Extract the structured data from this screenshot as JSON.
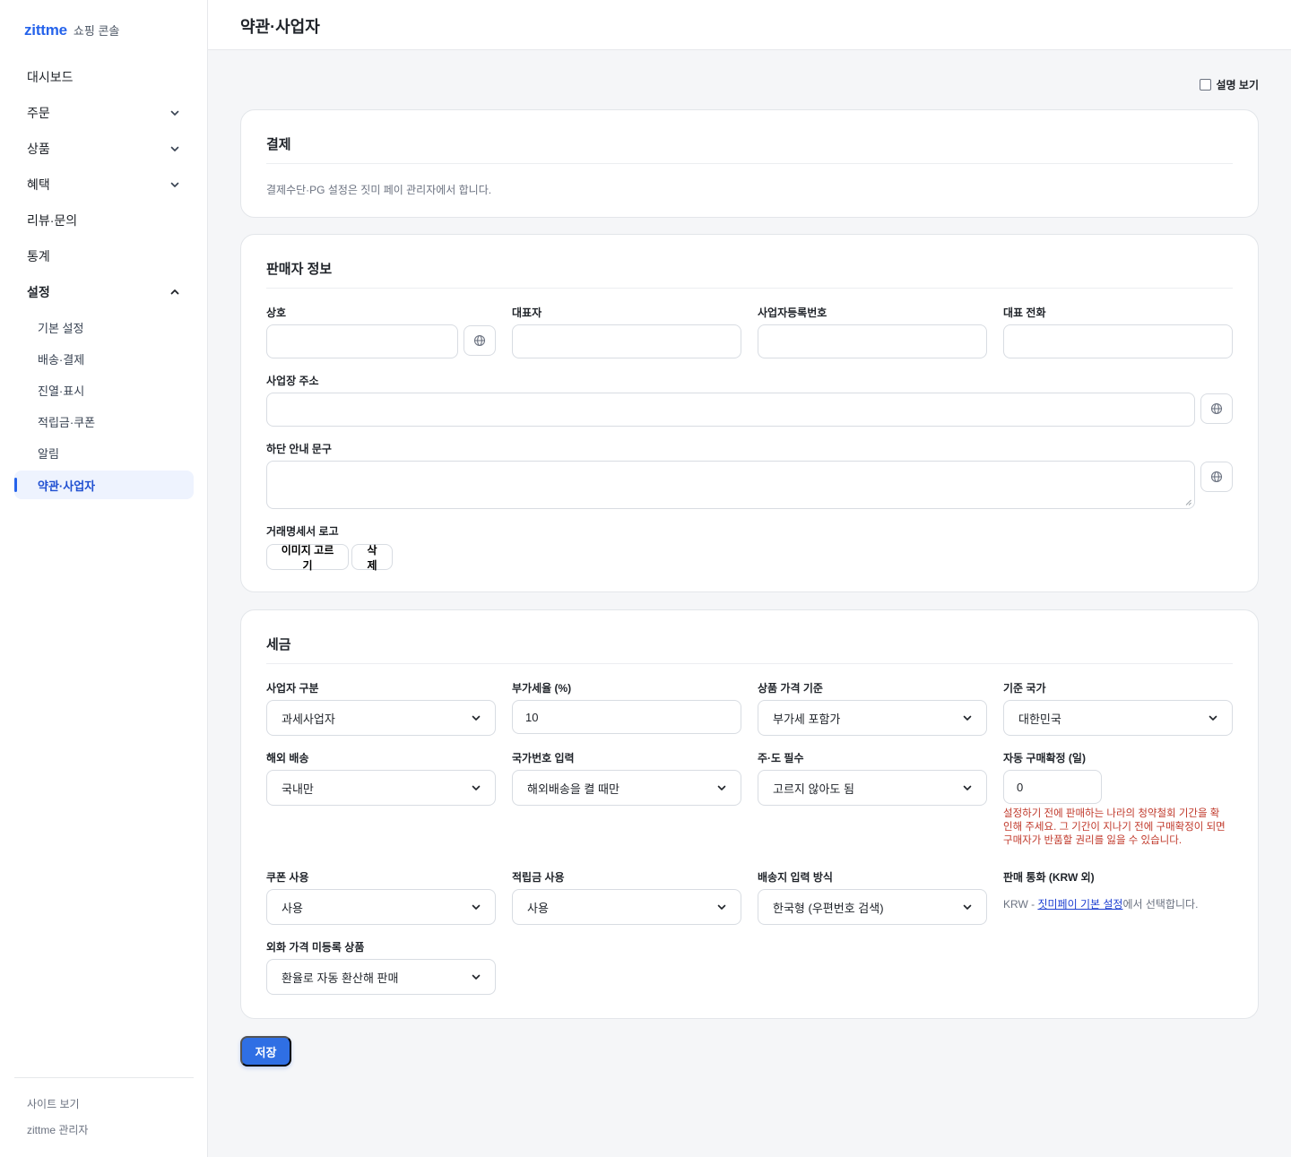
{
  "brand": {
    "logo": "zittme",
    "subtitle": "쇼핑 콘솔"
  },
  "nav": {
    "items": [
      {
        "label": "대시보드"
      },
      {
        "label": "주문"
      },
      {
        "label": "상품"
      },
      {
        "label": "혜택"
      },
      {
        "label": "리뷰·문의"
      },
      {
        "label": "통계"
      },
      {
        "label": "설정"
      }
    ],
    "sub": [
      {
        "label": "기본 설정"
      },
      {
        "label": "배송·결제"
      },
      {
        "label": "진열·표시"
      },
      {
        "label": "적립금·쿠폰"
      },
      {
        "label": "알림"
      },
      {
        "label": "약관·사업자"
      }
    ],
    "footer": {
      "view_site": "사이트 보기",
      "admin": "zittme 관리자"
    }
  },
  "header": {
    "title": "약관·사업자"
  },
  "help_toggle": {
    "label": "설명 보기",
    "checked": false
  },
  "payment": {
    "title": "결제",
    "text": "결제수단·PG 설정은 짓미 페이 관리자에서 합니다."
  },
  "seller": {
    "title": "판매자 정보",
    "company_label": "상호",
    "company_value": "",
    "ceo_label": "대표자",
    "ceo_value": "",
    "bizno_label": "사업자등록번호",
    "bizno_value": "",
    "phone_label": "대표 전화",
    "phone_value": "",
    "address_label": "사업장 주소",
    "address_value": "",
    "footer_label": "하단 안내 문구",
    "footer_value": "",
    "logo_label": "거래명세서 로고",
    "choose_image": "이미지 고르기",
    "delete": "삭제"
  },
  "tax": {
    "title": "세금",
    "biz_type_label": "사업자 구분",
    "biz_type_value": "과세사업자",
    "vat_label": "부가세율 (%)",
    "vat_value": "10",
    "price_basis_label": "상품 가격 기준",
    "price_basis_value": "부가세 포함가",
    "country_label": "기준 국가",
    "country_value": "대한민국",
    "overseas_label": "해외 배송",
    "overseas_value": "국내만",
    "dial_label": "국가번호 입력",
    "dial_value": "해외배송을 켤 때만",
    "state_label": "주·도 필수",
    "state_value": "고르지 않아도 됨",
    "autoconfirm_label": "자동 구매확정 (일)",
    "autoconfirm_value": "0",
    "autoconfirm_warning": "설정하기 전에 판매하는 나라의 청약철회 기간을 확인해 주세요. 그 기간이 지나기 전에 구매확정이 되면 구매자가 반품할 권리를 잃을 수 있습니다.",
    "coupon_label": "쿠폰 사용",
    "coupon_value": "사용",
    "points_label": "적립금 사용",
    "points_value": "사용",
    "addr_mode_label": "배송지 입력 방식",
    "addr_mode_value": "한국형 (우편번호 검색)",
    "currency_label": "판매 통화 (KRW 외)",
    "currency_prefix": "KRW - ",
    "currency_link": "짓미페이 기본 설정",
    "currency_suffix": "에서 선택합니다.",
    "fx_label": "외화 가격 미등록 상품",
    "fx_value": "환율로 자동 환산해 판매"
  },
  "save_label": "저장"
}
